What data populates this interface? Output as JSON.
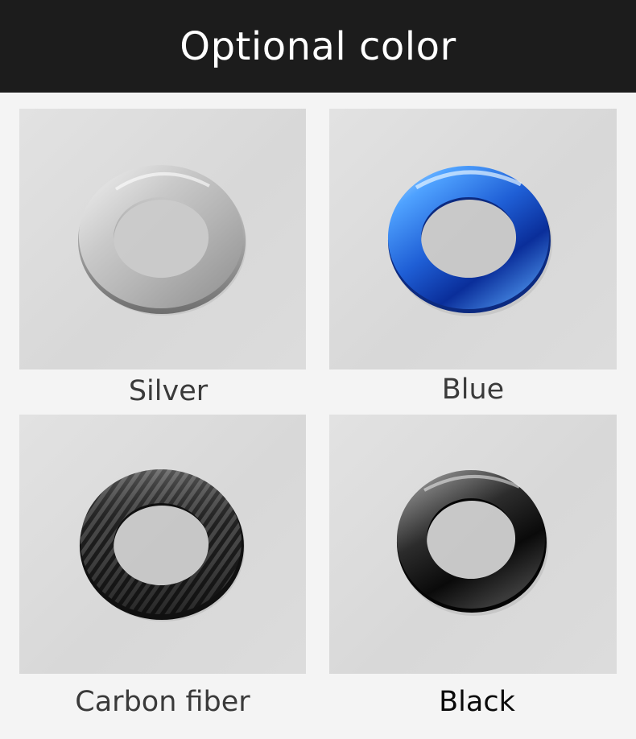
{
  "header": {
    "title": "Optional color"
  },
  "options": [
    {
      "label": "Silver",
      "color": "#c4c4c4"
    },
    {
      "label": "Blue",
      "color": "#2f7fe8"
    },
    {
      "label": "Carbon fiber",
      "color": "#2a2a2a"
    },
    {
      "label": "Black",
      "color": "#141414"
    }
  ]
}
